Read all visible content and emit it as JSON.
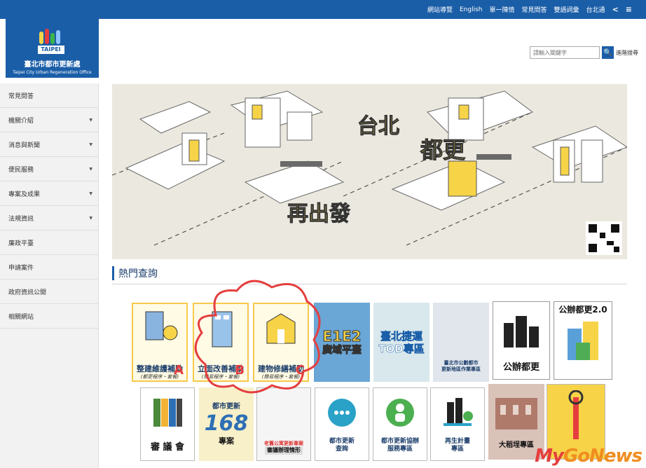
{
  "topnav": [
    "網站導覽",
    "English",
    "單一陳情",
    "常見問答",
    "雙語詞彙",
    "台北通"
  ],
  "logo": {
    "mark_text": "TAIPEI",
    "name": "臺北市都市更新處",
    "ename": "Taipei City Urban Regeneration Office"
  },
  "search": {
    "placeholder": "請輸入關鍵字",
    "button": "🔍",
    "advanced": "進階搜尋"
  },
  "sidebar": [
    {
      "label": "常見問答",
      "has_arrow": false
    },
    {
      "label": "機關介紹",
      "has_arrow": true
    },
    {
      "label": "消息與新聞",
      "has_arrow": true
    },
    {
      "label": "便民服務",
      "has_arrow": true
    },
    {
      "label": "專案及成果",
      "has_arrow": true
    },
    {
      "label": "法規資訊",
      "has_arrow": true
    },
    {
      "label": "廉政平臺",
      "has_arrow": false
    },
    {
      "label": "申請案件",
      "has_arrow": false
    },
    {
      "label": "政府資訊公開",
      "has_arrow": false
    },
    {
      "label": "相關網站",
      "has_arrow": false
    }
  ],
  "banner": {
    "title1": "台北",
    "title2": "都更",
    "title3": "再出發"
  },
  "section_title": "熱門查詢",
  "tiles_row1": [
    {
      "label": "整建維護補助",
      "sub": "(都更程序・套餐)",
      "letter": "A"
    },
    {
      "label": "立面改善補助",
      "sub": "(簡易程序・套餐)",
      "letter": "B"
    },
    {
      "label": "建物修繕補助",
      "sub": "(簡易程序・套餐)",
      "letter": "C"
    },
    {
      "label": "E1E2",
      "sub": "廣域平臺"
    },
    {
      "label": "臺北捷運",
      "sub": "TOD專區"
    },
    {
      "label": "臺北市公劃都市",
      "sub": "更新地區作業專區"
    },
    {
      "label": "公辦都更",
      "sub": ""
    },
    {
      "label": "公辦都更2.0",
      "sub": ""
    }
  ],
  "tiles_row2": [
    {
      "label": "審 議 會",
      "sub": ""
    },
    {
      "label": "都市更新",
      "big": "168",
      "sub": "專案"
    },
    {
      "label": "老舊公寓更新專案",
      "sub": "審議辦理情形"
    },
    {
      "label": "都市更新",
      "sub": "查詢"
    },
    {
      "label": "都市更新協辦",
      "sub": "服務專區"
    },
    {
      "label": "再生計畫",
      "sub": "專區"
    },
    {
      "label": "大稻埕專區",
      "sub": ""
    },
    {
      "label": "",
      "sub": ""
    }
  ],
  "watermark": {
    "a": "My",
    "b": "GoNews"
  },
  "colors": {
    "primary": "#1b5ea8",
    "accent_yellow": "#f7d348",
    "cloud_red": "#e53e3e"
  }
}
